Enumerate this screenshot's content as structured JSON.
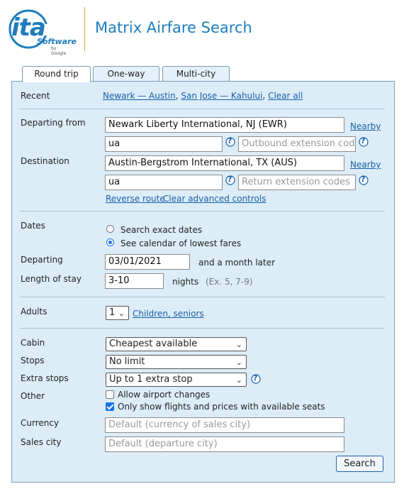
{
  "header": {
    "logo_text": "ita",
    "logo_sub": "Software",
    "logo_by": "by Google",
    "title": "Matrix Airfare Search"
  },
  "tabs": [
    {
      "label": "Round trip",
      "active": true
    },
    {
      "label": "One-way",
      "active": false
    },
    {
      "label": "Multi-city",
      "active": false
    }
  ],
  "recent": {
    "label": "Recent",
    "items": [
      "Newark — Austin",
      "San Jose — Kahului",
      "Clear all"
    ]
  },
  "route": {
    "departing_label": "Departing from",
    "departing_value": "Newark Liberty International, NJ (EWR)",
    "departing_nearby": "Nearby",
    "dep_routing_value": "ua",
    "dep_extension_placeholder": "Outbound extension codes",
    "destination_label": "Destination",
    "destination_value": "Austin-Bergstrom International, TX (AUS)",
    "destination_nearby": "Nearby",
    "dest_routing_value": "ua",
    "dest_extension_placeholder": "Return extension codes",
    "reverse_link": "Reverse route",
    "clear_advanced_link": "Clear advanced controls",
    "help_glyph": "?"
  },
  "dates": {
    "label": "Dates",
    "option_exact": "Search exact dates",
    "option_calendar": "See calendar of lowest fares",
    "selected": "calendar",
    "departing_label": "Departing",
    "departing_value": "03/01/2021",
    "departing_suffix": "and a month later",
    "stay_label": "Length of stay",
    "stay_value": "3-10",
    "stay_unit": "nights",
    "stay_hint": "(Ex. 5, 7-9)"
  },
  "passengers": {
    "label": "Adults",
    "value": "1",
    "link": "Children, seniors"
  },
  "options": {
    "cabin_label": "Cabin",
    "cabin_value": "Cheapest available",
    "stops_label": "Stops",
    "stops_value": "No limit",
    "extra_label": "Extra stops",
    "extra_value": "Up to 1 extra stop",
    "other_label": "Other",
    "airport_changes": "Allow airport changes",
    "airport_changes_checked": false,
    "available_seats": "Only show flights and prices with available seats",
    "available_seats_checked": true,
    "currency_label": "Currency",
    "currency_placeholder": "Default (currency of sales city)",
    "sales_label": "Sales city",
    "sales_placeholder": "Default (departure city)"
  },
  "search_button": "Search",
  "colors": {
    "accent": "#1d7dbd",
    "panel": "#dcedf8",
    "link": "#1a5fa8",
    "divider": "#e6a23c"
  }
}
